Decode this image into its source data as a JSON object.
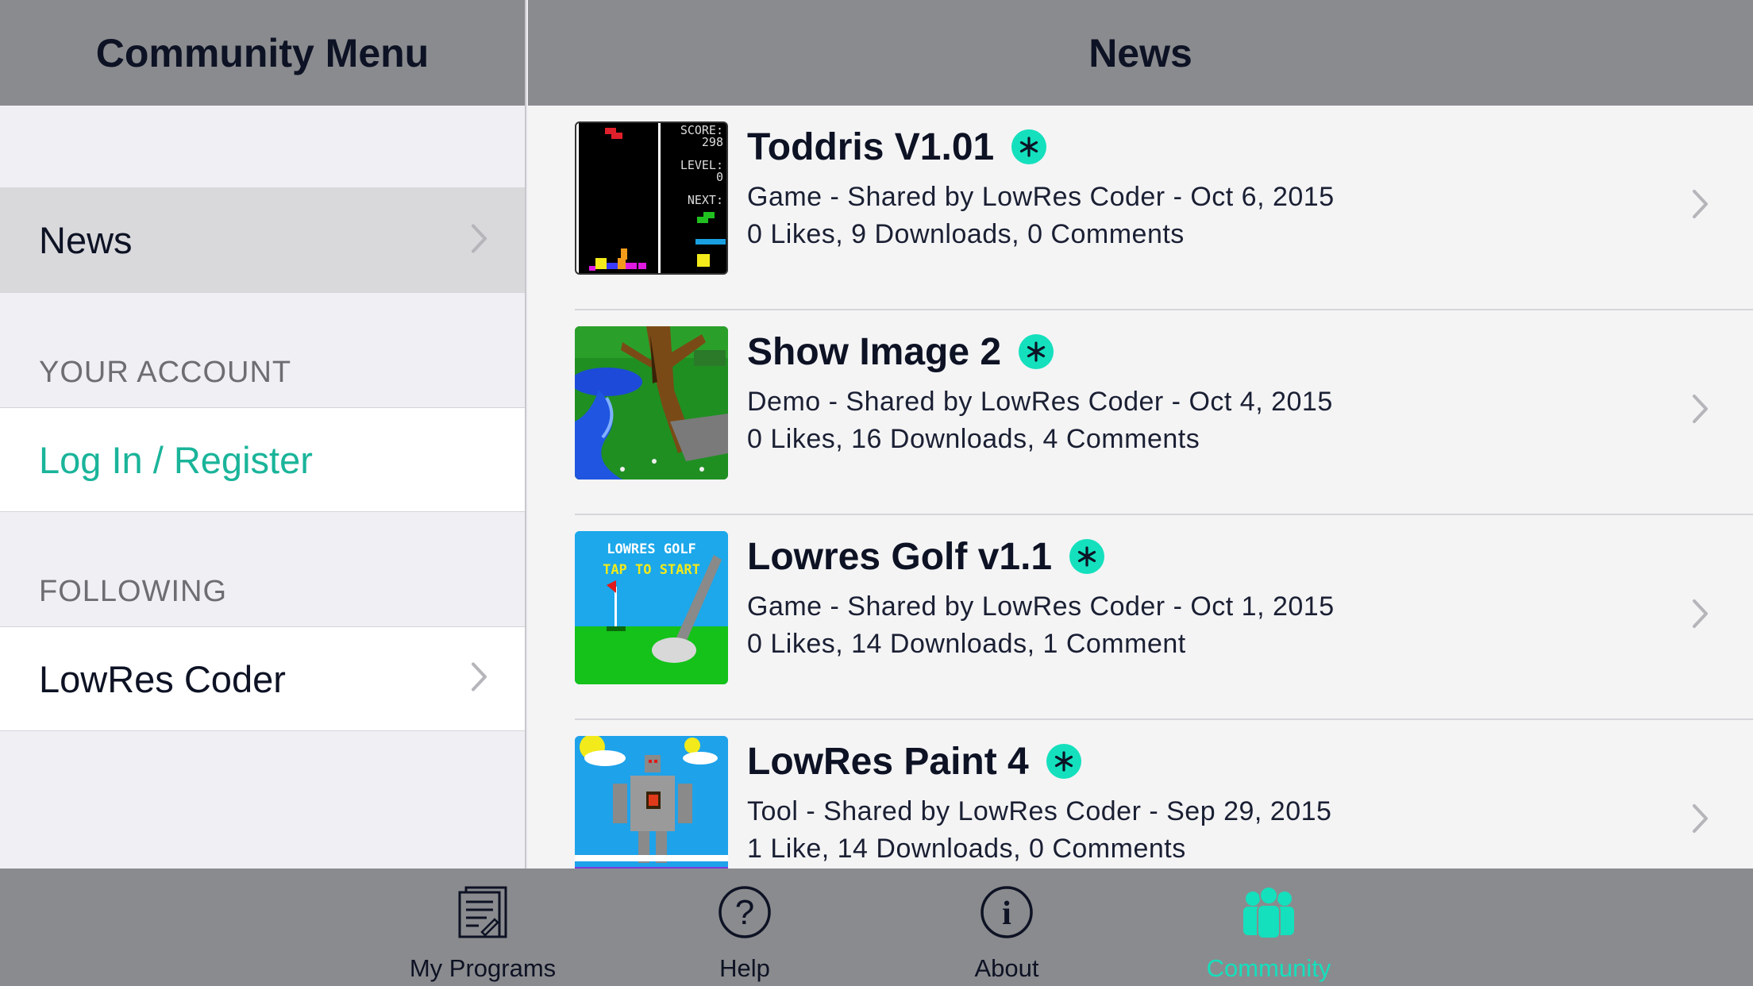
{
  "sidebar": {
    "title": "Community Menu",
    "news_item": "News",
    "account_header": "YOUR ACCOUNT",
    "login_item": "Log In / Register",
    "following_header": "FOLLOWING",
    "following_items": [
      "LowRes Coder"
    ]
  },
  "main": {
    "title": "News",
    "posts": [
      {
        "title": "Toddris V1.01",
        "meta": "Game - Shared by LowRes Coder - Oct 6, 2015",
        "stats": "0 Likes, 9 Downloads, 0 Comments",
        "thumb_score": "SCORE:",
        "thumb_score_val": "298",
        "thumb_level": "LEVEL:",
        "thumb_level_val": "0",
        "thumb_next": "NEXT:"
      },
      {
        "title": "Show Image 2",
        "meta": "Demo - Shared by LowRes Coder - Oct 4, 2015",
        "stats": "0 Likes, 16 Downloads, 4 Comments"
      },
      {
        "title": "Lowres Golf v1.1",
        "meta": "Game - Shared by LowRes Coder - Oct 1, 2015",
        "stats": "0 Likes, 14 Downloads, 1 Comment",
        "thumb_line1": "LOWRES GOLF",
        "thumb_line2": "TAP TO START"
      },
      {
        "title": "LowRes Paint 4",
        "meta": "Tool - Shared by LowRes Coder - Sep 29, 2015",
        "stats": "1 Like, 14 Downloads, 0 Comments"
      }
    ]
  },
  "tabbar": {
    "tabs": [
      {
        "label": "My Programs",
        "icon": "document-icon"
      },
      {
        "label": "Help",
        "icon": "question-icon"
      },
      {
        "label": "About",
        "icon": "info-icon"
      },
      {
        "label": "Community",
        "icon": "people-icon",
        "active": true
      }
    ]
  },
  "colors": {
    "accent": "#14e0bd",
    "link": "#1ab49a",
    "bar": "#8a8b8e"
  }
}
